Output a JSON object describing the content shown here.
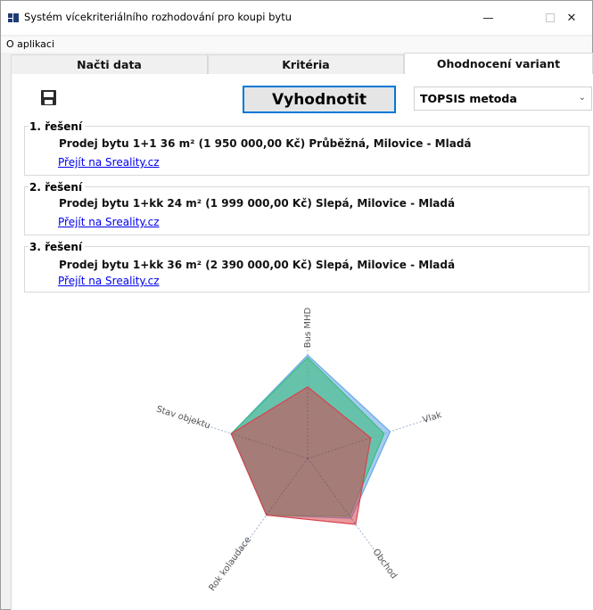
{
  "window": {
    "title": "Systém vícekriteriálního rozhodování pro koupi bytu",
    "controls": {
      "minimize": "—",
      "maximize": "☐",
      "close": "✕"
    }
  },
  "menu": {
    "items": [
      {
        "label": "O aplikaci"
      }
    ]
  },
  "tabs": [
    {
      "label": "Načti data",
      "active": false
    },
    {
      "label": "Kritéria",
      "active": false
    },
    {
      "label": "Ohodnocení variant",
      "active": true
    }
  ],
  "toolbar": {
    "save_icon": "floppy-disk-icon",
    "evaluate_label": "Vyhodnotit",
    "method_selected": "TOPSIS metoda"
  },
  "results": [
    {
      "title": "1. řešení",
      "description": "Prodej bytu 1+1 36 m² (1 950 000,00 Kč) Průběžná, Milovice - Mladá",
      "link": "Přejít na Sreality.cz"
    },
    {
      "title": "2. řešení",
      "description": "Prodej bytu 1+kk 24 m² (1 999 000,00 Kč) Slepá, Milovice - Mladá",
      "link": "Přejít na Sreality.cz"
    },
    {
      "title": "3. řešení",
      "description": "Prodej bytu 1+kk 36 m² (2 390 000,00 Kč) Slepá, Milovice - Mladá",
      "link": "Přejít na Sreality.cz"
    }
  ],
  "chart_data": {
    "type": "radar",
    "axes": [
      "Bus MHD",
      "Vlak",
      "Obchod",
      "Rok kolaudace",
      "Stav objektu"
    ],
    "range": [
      0,
      1
    ],
    "grid": false,
    "series": [
      {
        "color": "#6aa9e8",
        "values": [
          0.81,
          0.68,
          0.58,
          0.55,
          0.63
        ]
      },
      {
        "color": "#3dbd7d",
        "values": [
          0.79,
          0.63,
          0.56,
          0.55,
          0.63
        ]
      },
      {
        "color": "#d8444e",
        "values": [
          0.56,
          0.52,
          0.64,
          0.55,
          0.63
        ]
      }
    ]
  }
}
